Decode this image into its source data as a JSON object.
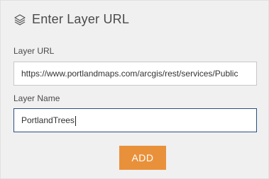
{
  "header": {
    "icon": "layers-icon",
    "title": "Enter Layer URL"
  },
  "layer_url": {
    "label": "Layer URL",
    "value": "https://www.portlandmaps.com/arcgis/rest/services/Public"
  },
  "layer_name": {
    "label": "Layer Name",
    "value": "PortlandTrees"
  },
  "actions": {
    "add_label": "ADD"
  },
  "colors": {
    "accent": "#e9913a",
    "focus_border": "#2a4f80"
  }
}
